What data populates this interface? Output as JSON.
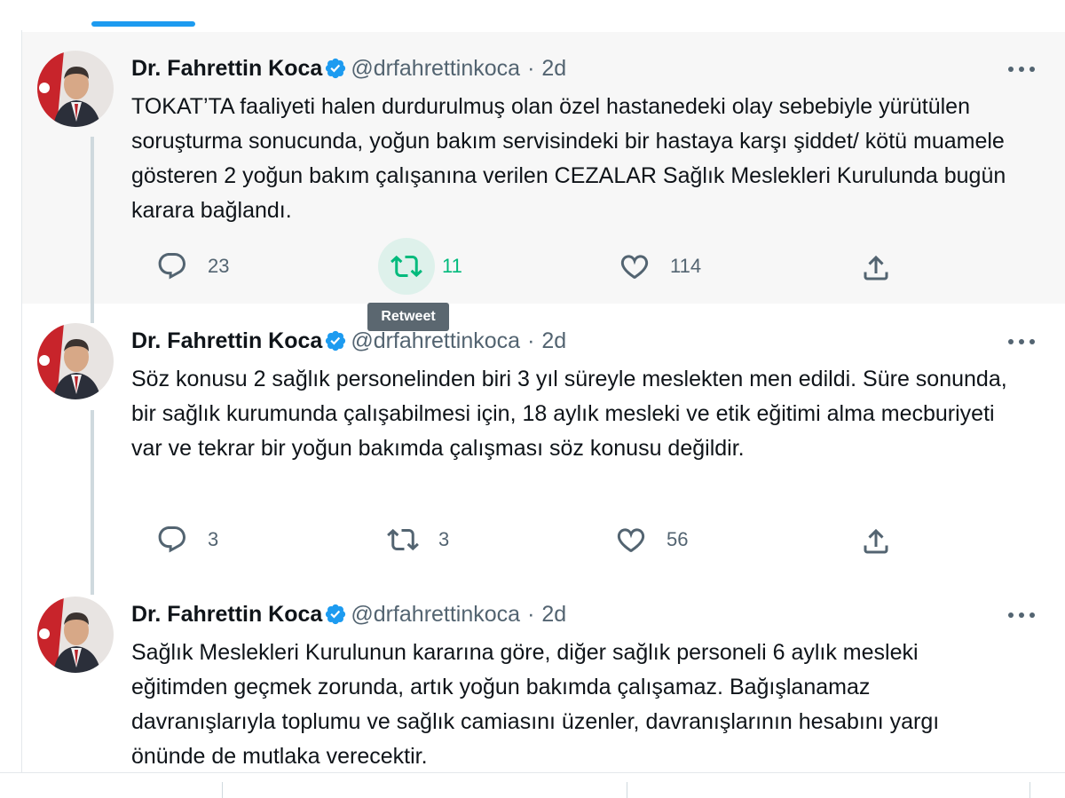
{
  "colors": {
    "accent": "#1d9bf0",
    "retweet_active": "#00ba7c",
    "muted": "#536471",
    "text": "#0f1419"
  },
  "tooltip": {
    "text": "Retweet"
  },
  "tweets": [
    {
      "author": {
        "name": "Dr. Fahrettin Koca",
        "handle": "@drfahrettinkoca",
        "verified_icon": "verified-badge-icon"
      },
      "time": "2d",
      "text": "TOKAT’TA faaliyeti halen durdurulmuş olan özel hastanedeki olay sebebiyle yürütülen soruşturma sonucunda, yoğun bakım servisindeki bir hastaya karşı şiddet/ kötü muamele gösteren 2 yoğun bakım çalışanına verilen CEZALAR Sağlık Meslekleri Kurulunda bugün karara bağlandı.",
      "replies": "23",
      "retweets": "11",
      "likes": "114"
    },
    {
      "author": {
        "name": "Dr. Fahrettin Koca",
        "handle": "@drfahrettinkoca",
        "verified_icon": "verified-badge-icon"
      },
      "time": "2d",
      "text": "Söz konusu 2 sağlık personelinden biri 3 yıl süreyle meslekten men edildi. Süre sonunda, bir sağlık kurumunda çalışabilmesi için, 18 aylık mesleki ve etik eğitimi alma mecburiyeti var ve tekrar bir yoğun bakımda çalışması söz konusu değildir.",
      "replies": "3",
      "retweets": "3",
      "likes": "56"
    },
    {
      "author": {
        "name": "Dr. Fahrettin Koca",
        "handle": "@drfahrettinkoca",
        "verified_icon": "verified-badge-icon"
      },
      "time": "2d",
      "text": "Sağlık Meslekleri Kurulunun kararına göre, diğer sağlık personeli 6 aylık mesleki eğitimden geçmek zorunda, artık yoğun bakımda çalışamaz. Bağışlanamaz davranışlarıyla toplumu ve sağlık camiasını üzenler, davranışlarının hesabını yargı önünde de mutlaka verecektir."
    }
  ]
}
